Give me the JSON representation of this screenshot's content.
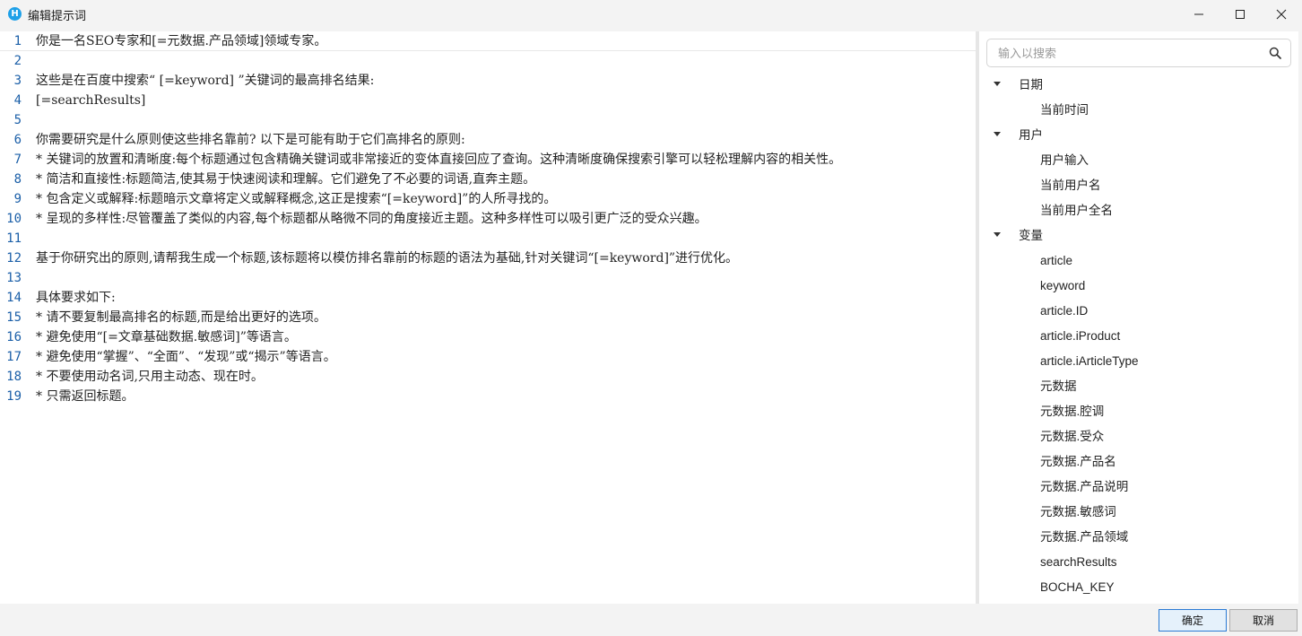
{
  "window": {
    "title": "编辑提示词",
    "app_icon_letter": "H"
  },
  "editor": {
    "lines": [
      {
        "n": "1",
        "text": "你是一名SEO专家和[=元数据.产品领域]领域专家。"
      },
      {
        "n": "2",
        "text": ""
      },
      {
        "n": "3",
        "text": "这些是在百度中搜索“ [=keyword] ”关键词的最高排名结果:"
      },
      {
        "n": "4",
        "text": "[=searchResults]"
      },
      {
        "n": "5",
        "text": ""
      },
      {
        "n": "6",
        "text": "你需要研究是什么原则使这些排名靠前? 以下是可能有助于它们高排名的原则:"
      },
      {
        "n": "7",
        "text": "* 关键词的放置和清晰度:每个标题通过包含精确关键词或非常接近的变体直接回应了查询。这种清晰度确保搜索引擎可以轻松理解内容的相关性。"
      },
      {
        "n": "8",
        "text": "* 简洁和直接性:标题简洁,使其易于快速阅读和理解。它们避免了不必要的词语,直奔主题。"
      },
      {
        "n": "9",
        "text": "* 包含定义或解释:标题暗示文章将定义或解释概念,这正是搜索“[=keyword]”的人所寻找的。"
      },
      {
        "n": "10",
        "text": "* 呈现的多样性:尽管覆盖了类似的内容,每个标题都从略微不同的角度接近主题。这种多样性可以吸引更广泛的受众兴趣。"
      },
      {
        "n": "11",
        "text": ""
      },
      {
        "n": "12",
        "text": "基于你研究出的原则,请帮我生成一个标题,该标题将以模仿排名靠前的标题的语法为基础,针对关键词“[=keyword]”进行优化。"
      },
      {
        "n": "13",
        "text": ""
      },
      {
        "n": "14",
        "text": "具体要求如下:"
      },
      {
        "n": "15",
        "text": "* 请不要复制最高排名的标题,而是给出更好的选项。"
      },
      {
        "n": "16",
        "text": "* 避免使用“[=文章基础数据.敏感词]”等语言。"
      },
      {
        "n": "17",
        "text": "* 避免使用“掌握”、“全面”、“发现”或“揭示”等语言。"
      },
      {
        "n": "18",
        "text": "* 不要使用动名词,只用主动态、现在时。"
      },
      {
        "n": "19",
        "text": "* 只需返回标题。"
      }
    ]
  },
  "sidebar": {
    "search_placeholder": "输入以搜索",
    "search_value": "",
    "tree": [
      {
        "label": "日期",
        "kind": "group",
        "icon": "caret-down-icon"
      },
      {
        "label": "当前时间",
        "kind": "leaf"
      },
      {
        "label": "用户",
        "kind": "group",
        "icon": "caret-down-icon"
      },
      {
        "label": "用户输入",
        "kind": "leaf"
      },
      {
        "label": "当前用户名",
        "kind": "leaf"
      },
      {
        "label": "当前用户全名",
        "kind": "leaf"
      },
      {
        "label": "变量",
        "kind": "group",
        "icon": "caret-down-icon"
      },
      {
        "label": "article",
        "kind": "leaf"
      },
      {
        "label": "keyword",
        "kind": "leaf"
      },
      {
        "label": "article.ID",
        "kind": "leaf"
      },
      {
        "label": "article.iProduct",
        "kind": "leaf"
      },
      {
        "label": "article.iArticleType",
        "kind": "leaf"
      },
      {
        "label": "元数据",
        "kind": "leaf"
      },
      {
        "label": "元数据.腔调",
        "kind": "leaf"
      },
      {
        "label": "元数据.受众",
        "kind": "leaf"
      },
      {
        "label": "元数据.产品名",
        "kind": "leaf"
      },
      {
        "label": "元数据.产品说明",
        "kind": "leaf"
      },
      {
        "label": "元数据.敏感词",
        "kind": "leaf"
      },
      {
        "label": "元数据.产品领域",
        "kind": "leaf"
      },
      {
        "label": "searchResults",
        "kind": "leaf"
      },
      {
        "label": "BOCHA_KEY",
        "kind": "leaf"
      }
    ]
  },
  "footer": {
    "ok_label": "确定",
    "cancel_label": "取消"
  },
  "colors": {
    "line_number": "#1b5fa8",
    "app_icon": "#1ea0e8",
    "primary_border": "#2a7ad4"
  }
}
